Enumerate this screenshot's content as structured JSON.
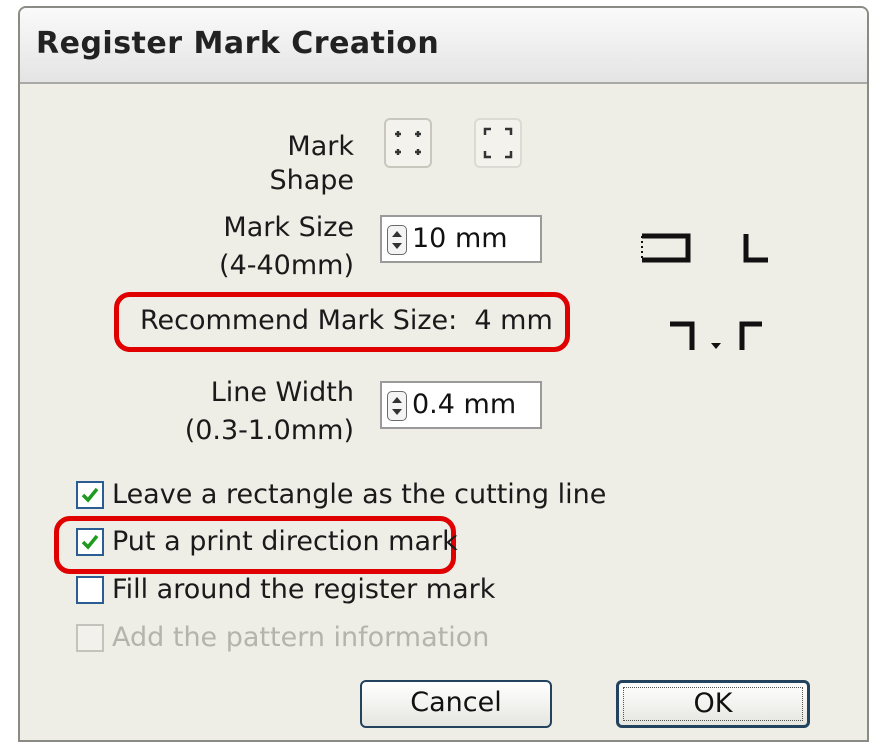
{
  "window": {
    "title": "Register Mark Creation"
  },
  "mark_shape": {
    "label": "Mark Shape",
    "options": [
      {
        "icon": "corner-marks-inner-icon"
      },
      {
        "icon": "corner-marks-outer-icon"
      }
    ]
  },
  "mark_size": {
    "label": "Mark Size",
    "range": "(4-40mm)",
    "value": "10 mm"
  },
  "recommend": {
    "text": "Recommend Mark Size:  4 mm"
  },
  "line_width": {
    "label": "Line Width",
    "range": "(0.3-1.0mm)",
    "value": "0.4 mm"
  },
  "options": [
    {
      "label": "Leave a rectangle as the cutting line",
      "checked": true,
      "enabled": true
    },
    {
      "label": "Put a print direction mark",
      "checked": true,
      "enabled": true
    },
    {
      "label": "Fill around the register mark",
      "checked": false,
      "enabled": true
    },
    {
      "label": "Add the pattern information",
      "checked": false,
      "enabled": false
    }
  ],
  "buttons": {
    "cancel": "Cancel",
    "ok": "OK"
  },
  "colors": {
    "highlight": "#e00000",
    "check": "#1f9a1f",
    "dialog_bg": "#eeede6"
  }
}
